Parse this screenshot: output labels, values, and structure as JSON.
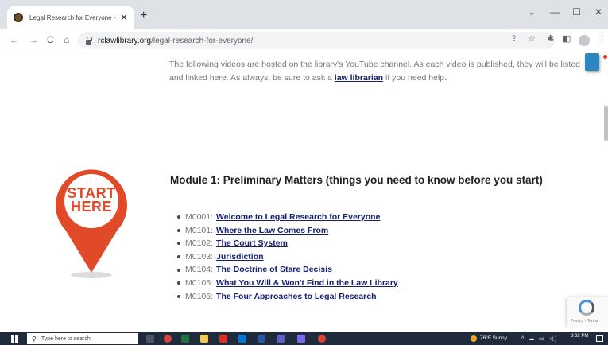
{
  "browser": {
    "tab_title": "Legal Research for Everyone - Riverside Co",
    "tab_close": "✕",
    "new_tab": "+",
    "window_controls": {
      "dropdown": "⌄",
      "minimize": "—",
      "maximize": "☐",
      "close": "✕"
    },
    "nav": {
      "back": "←",
      "forward": "→",
      "reload": "C",
      "home": "⌂"
    },
    "url_domain": "rclawlibrary.org",
    "url_path": "/legal-research-for-everyone/",
    "toolbar_icons": {
      "share": "⇪",
      "star": "☆",
      "extensions": "✱",
      "sidepanel": "◧",
      "menu": "⋮"
    }
  },
  "page": {
    "intro_before": "The following videos are hosted on the library's YouTube channel. As each video is published, they will be listed and linked here. As always, be sure to ask a ",
    "intro_link": "law librarian",
    "intro_after": " if you need help.",
    "start_here_line1": "START",
    "start_here_line2": "HERE",
    "module_heading": "Module 1: Preliminary Matters (things you need to know before you start)",
    "lessons": [
      {
        "code": "M0001:",
        "title": "Welcome to Legal Research for Everyone"
      },
      {
        "code": "M0101:",
        "title": "Where the Law Comes From"
      },
      {
        "code": "M0102:",
        "title": "The Court System"
      },
      {
        "code": "M0103:",
        "title": "Jurisdiction"
      },
      {
        "code": "M0104:",
        "title": "The Doctrine of Stare Decisis"
      },
      {
        "code": "M0105:",
        "title": "What You Will & Won't Find in the Law Library"
      },
      {
        "code": "M0106:",
        "title": "The Four Approaches to Legal Research"
      }
    ],
    "recaptcha_links": "Privacy - Terms"
  },
  "taskbar": {
    "search_placeholder": "Type here to search",
    "search_icon": "⚲",
    "weather": "76°F  Sunny",
    "tray_icons": "^ ☁ ▭ ◁)",
    "time": "3:32 PM"
  },
  "colors": {
    "accent_red": "#e14a29",
    "link_navy": "#16206b",
    "taskbar": "#1f2a3a"
  }
}
